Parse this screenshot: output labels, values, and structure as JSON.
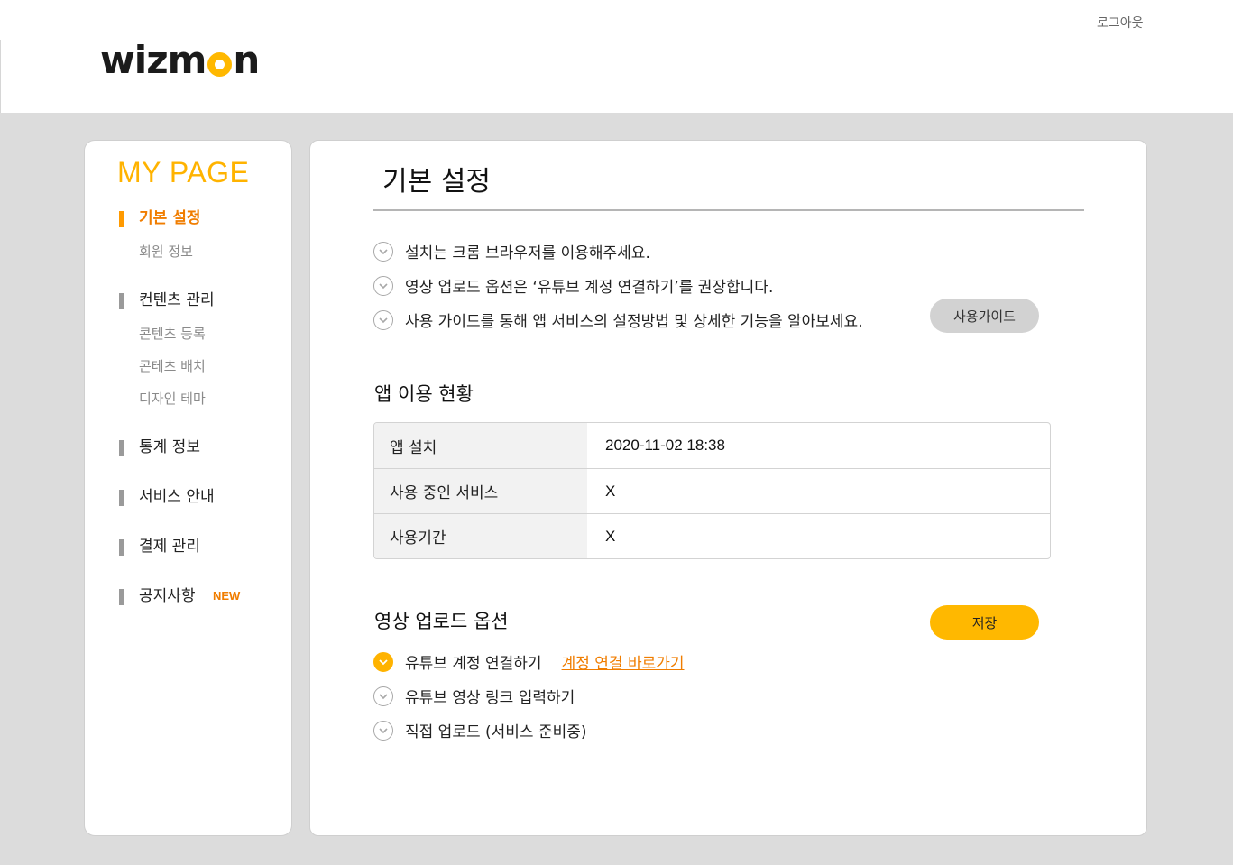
{
  "header": {
    "logo_text_before": "wizm",
    "logo_text_after": "n",
    "logout_label": "로그아웃",
    "brand_color": "#ffb800"
  },
  "sidebar": {
    "title": "MY PAGE",
    "groups": [
      {
        "label": "기본 설정",
        "active": true,
        "items": [
          "회원 정보"
        ]
      },
      {
        "label": "컨텐츠 관리",
        "active": false,
        "items": [
          "콘텐츠 등록",
          "콘테츠 배치",
          "디자인 테마"
        ]
      },
      {
        "label": "통계 정보",
        "active": false,
        "items": []
      },
      {
        "label": "서비스 안내",
        "active": false,
        "items": []
      },
      {
        "label": "결제 관리",
        "active": false,
        "items": []
      },
      {
        "label": "공지사항",
        "active": false,
        "items": [],
        "badge": "NEW"
      }
    ]
  },
  "main": {
    "title": "기본 설정",
    "notices": [
      "설치는 크롬 브라우저를 이용해주세요.",
      "영상 업로드 옵션은 ‘유튜브 계정 연결하기’를 권장합니다.",
      "사용 가이드를 통해 앱 서비스의 설정방법 및 상세한 기능을 알아보세요."
    ],
    "guide_button": "사용가이드",
    "usage_section": {
      "title": "앱 이용 현황",
      "rows": [
        {
          "label": "앱 설치",
          "value": "2020-11-02 18:38"
        },
        {
          "label": "사용 중인 서비스",
          "value": "X"
        },
        {
          "label": "사용기간",
          "value": "X"
        }
      ]
    },
    "upload_section": {
      "title": "영상 업로드 옵션",
      "save_button": "저장",
      "options": [
        {
          "label": "유튜브 계정 연결하기",
          "selected": true,
          "link": "계정 연결 바로가기"
        },
        {
          "label": "유튜브 영상 링크 입력하기",
          "selected": false
        },
        {
          "label": "직접 업로드 (서비스 준비중)",
          "selected": false
        }
      ]
    }
  }
}
